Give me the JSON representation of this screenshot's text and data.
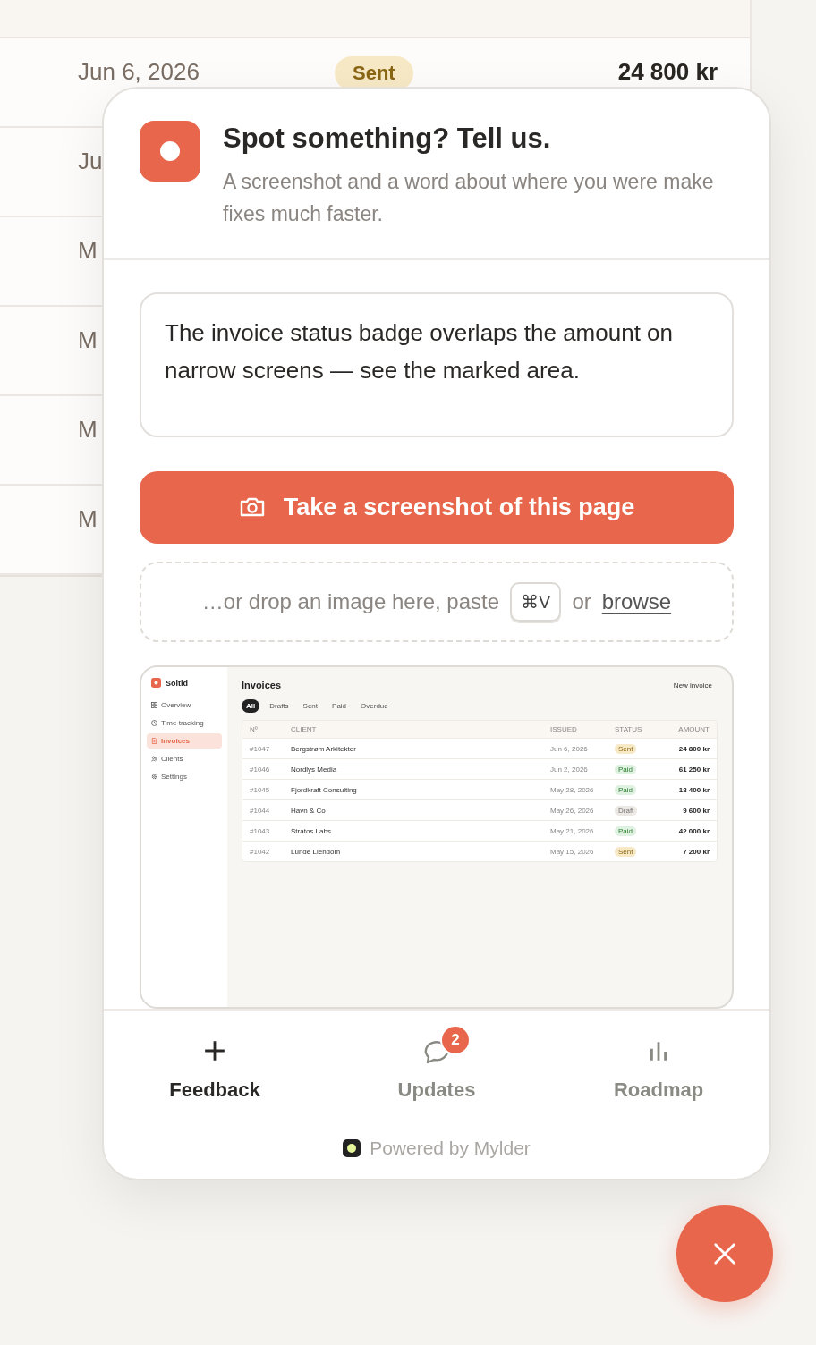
{
  "background_table": {
    "rows": [
      {
        "issued": "Jun 6, 2026",
        "status": "Sent",
        "kind": "sent",
        "amount": "24 800 kr"
      },
      {
        "issued": "Ju"
      },
      {
        "issued": "M"
      },
      {
        "issued": "M"
      },
      {
        "issued": "M"
      },
      {
        "issued": "M"
      }
    ]
  },
  "feedback_panel": {
    "title": "Spot something? Tell us.",
    "subtitle": "A screenshot and a word about where you were make fixes much faster.",
    "message": {
      "value": "The invoice status badge overlaps the amount on narrow screens — see the marked area."
    },
    "screenshot_button": "Take a screenshot of this page",
    "drop_zone": {
      "text": "…or drop an image here, paste",
      "key": "⌘V",
      "or": "or",
      "link": "browse"
    },
    "preview": {
      "app_name": "Soltid",
      "nav": [
        {
          "label": "Overview",
          "selected": false
        },
        {
          "label": "Time tracking",
          "selected": false
        },
        {
          "label": "Invoices",
          "selected": true
        },
        {
          "label": "Clients",
          "selected": false
        },
        {
          "label": "Settings",
          "selected": false
        }
      ],
      "heading": "Invoices",
      "action": "New invoice",
      "filters": [
        {
          "label": "All",
          "selected": true
        },
        {
          "label": "Drafts",
          "selected": false
        },
        {
          "label": "Sent",
          "selected": false
        },
        {
          "label": "Paid",
          "selected": false
        },
        {
          "label": "Overdue",
          "selected": false
        }
      ],
      "columns": [
        "Nº",
        "CLIENT",
        "ISSUED",
        "STATUS",
        "AMOUNT"
      ],
      "rows": [
        {
          "number": "#1047",
          "client": "Bergstrøm Arkitekter",
          "issued": "Jun 6, 2026",
          "status": "Sent",
          "kind": "sent",
          "amount": "24 800 kr"
        },
        {
          "number": "#1046",
          "client": "Nordlys Media",
          "issued": "Jun 2, 2026",
          "status": "Paid",
          "kind": "paid",
          "amount": "61 250 kr"
        },
        {
          "number": "#1045",
          "client": "Fjordkraft Consulting",
          "issued": "May 28, 2026",
          "status": "Paid",
          "kind": "paid",
          "amount": "18 400 kr"
        },
        {
          "number": "#1044",
          "client": "Havn & Co",
          "issued": "May 26, 2026",
          "status": "Draft",
          "kind": "draft",
          "amount": "9 600 kr"
        },
        {
          "number": "#1043",
          "client": "Stratos Labs",
          "issued": "May 21, 2026",
          "status": "Paid",
          "kind": "paid",
          "amount": "42 000 kr"
        },
        {
          "number": "#1042",
          "client": "Lunde Liendom",
          "issued": "May 15, 2026",
          "status": "Sent",
          "kind": "sent",
          "amount": "7 200 kr"
        }
      ]
    },
    "tabs": [
      {
        "label": "Feedback",
        "selected": true
      },
      {
        "label": "Updates",
        "badge": "2",
        "selected": false
      },
      {
        "label": "Roadmap",
        "selected": false
      }
    ],
    "powered_by": "Powered by Mylder"
  }
}
